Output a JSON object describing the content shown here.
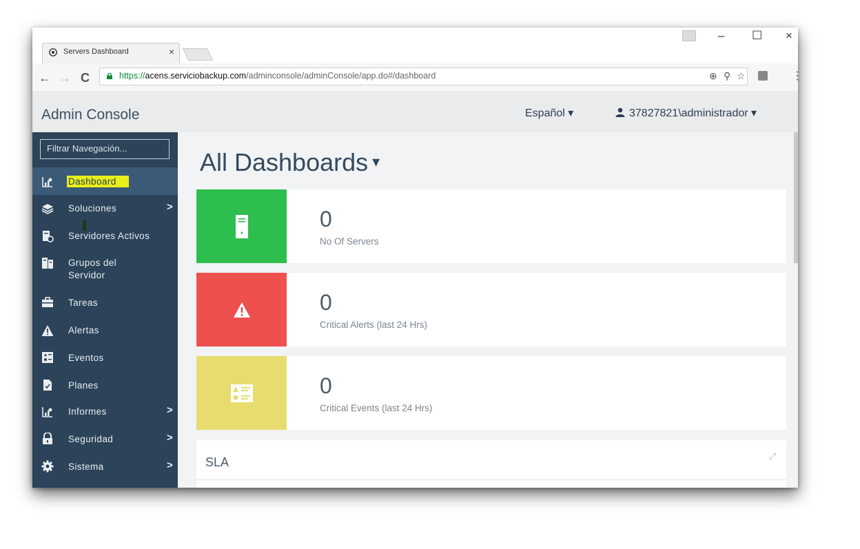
{
  "browser": {
    "tab_title": "Servers Dashboard",
    "tab_close": "×",
    "nav_back": "←",
    "nav_forward": "→",
    "nav_reload": "C",
    "url_scheme": "https://",
    "url_host": "acens.serviciobackup.com",
    "url_path": "/adminconsole/adminConsole/app.do#/dashboard",
    "win_minimize": "–",
    "win_maximize": "☐",
    "win_close": "×",
    "icons": [
      "zoom-icon",
      "key-icon",
      "star-icon",
      "extension-icon",
      "menu-icon"
    ]
  },
  "header": {
    "brand": "Admin Console",
    "language": "Español ▾",
    "user": "37827821\\administrador ▾"
  },
  "sidebar": {
    "filter_placeholder": "Filtrar Navegación...",
    "items": [
      {
        "label": "Dashboard",
        "icon": "dashboard-icon",
        "active": true
      },
      {
        "label": "Soluciones",
        "icon": "layers-icon",
        "chevron": ">"
      },
      {
        "label": "Servidores Activos",
        "icon": "server-gear-icon"
      },
      {
        "label_line1": "Grupos del",
        "label_line2": "Servidor",
        "icon": "server-group-icon"
      },
      {
        "label": "Tareas",
        "icon": "briefcase-icon"
      },
      {
        "label": "Alertas",
        "icon": "warning-icon"
      },
      {
        "label": "Eventos",
        "icon": "events-icon"
      },
      {
        "label": "Planes",
        "icon": "plan-icon"
      },
      {
        "label": "Informes",
        "icon": "report-icon",
        "chevron": ">"
      },
      {
        "label": "Seguridad",
        "icon": "lock-icon",
        "chevron": ">"
      },
      {
        "label": "Sistema",
        "icon": "gear-icon",
        "chevron": ">"
      }
    ]
  },
  "main": {
    "title": "All Dashboards",
    "title_caret": "▾",
    "cards": [
      {
        "value": "0",
        "label": "No Of Servers",
        "color": "#2dbe4e",
        "icon": "server-icon"
      },
      {
        "value": "0",
        "label": "Critical Alerts (last 24 Hrs)",
        "color": "#ee5050",
        "icon": "warning-icon"
      },
      {
        "value": "0",
        "label": "Critical Events (last 24 Hrs)",
        "color": "#e8dc6e",
        "icon": "events-icon"
      }
    ],
    "sla_title": "SLA"
  },
  "colors": {
    "sidebar_bg": "#2c4359",
    "sidebar_active": "#3b5a77",
    "highlight": "#e8ef1a",
    "header_bg": "#e9ebed"
  }
}
